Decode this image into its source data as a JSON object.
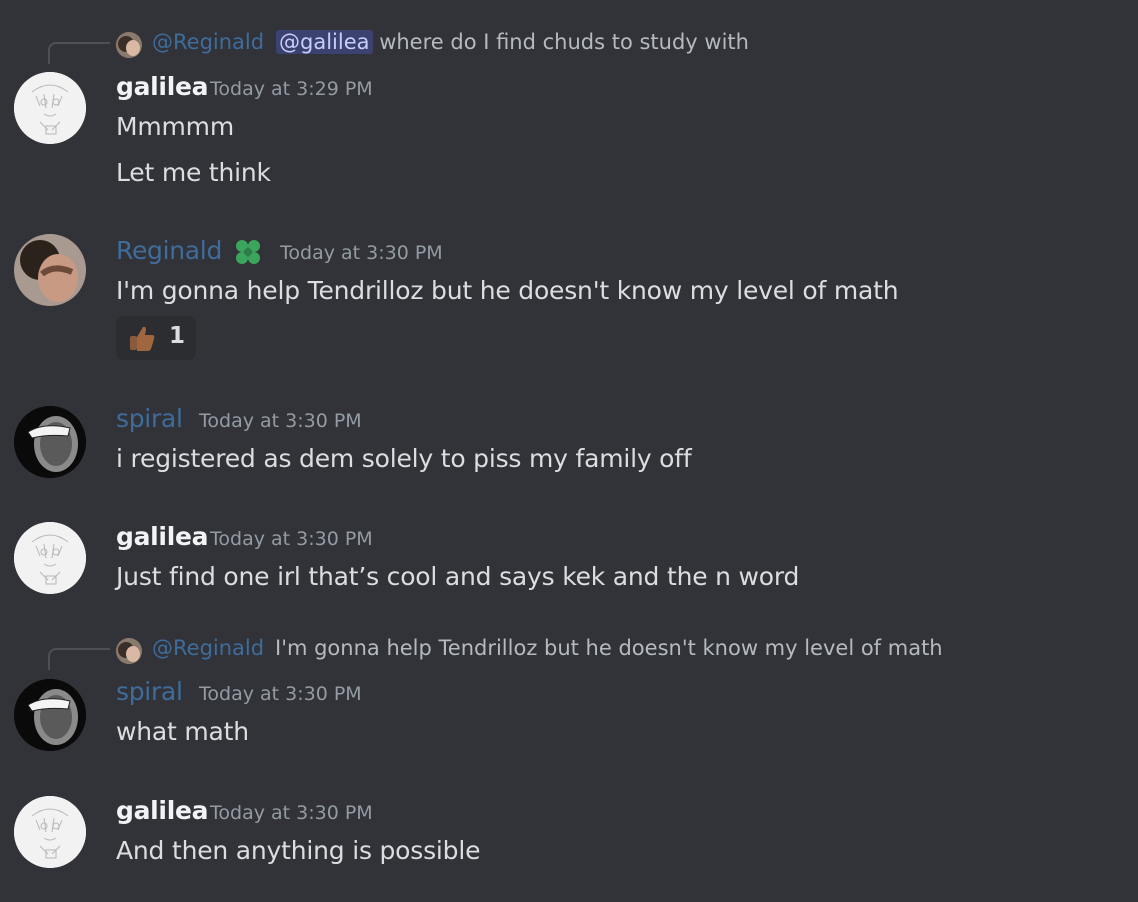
{
  "reply1": {
    "author": "@Reginald",
    "mention": "@galilea",
    "text": "where do I find chuds to study with"
  },
  "messages": [
    {
      "author": "galilea",
      "timestamp": "Today at 3:29 PM",
      "lines": [
        "Mmmmm",
        "Let me think"
      ]
    },
    {
      "author": "Reginald",
      "timestamp": "Today at 3:30 PM",
      "lines": [
        "I'm gonna help Tendrilloz but he doesn't know my level of math"
      ],
      "reaction": {
        "emoji": "thumbs-up-icon",
        "count": "1"
      }
    },
    {
      "author": "spiral",
      "timestamp": "Today at 3:30 PM",
      "lines": [
        "i registered as dem solely to piss my family off"
      ]
    },
    {
      "author": "galilea",
      "timestamp": "Today at 3:30 PM",
      "lines": [
        "Just find one irl that’s cool and says kek and the n word"
      ]
    },
    {
      "author": "spiral",
      "timestamp": "Today at 3:30 PM",
      "lines": [
        "what math"
      ]
    },
    {
      "author": "galilea",
      "timestamp": "Today at 3:30 PM",
      "lines": [
        "And then anything is possible"
      ]
    }
  ],
  "reply2": {
    "author": "@Reginald",
    "text": "I'm gonna help Tendrilloz but he doesn't know my level of math"
  },
  "colors": {
    "background": "#313338",
    "name_blue": "#3f6c9b",
    "reginald_badge": "#3ba55d",
    "mention_bg": "#3c4270"
  }
}
